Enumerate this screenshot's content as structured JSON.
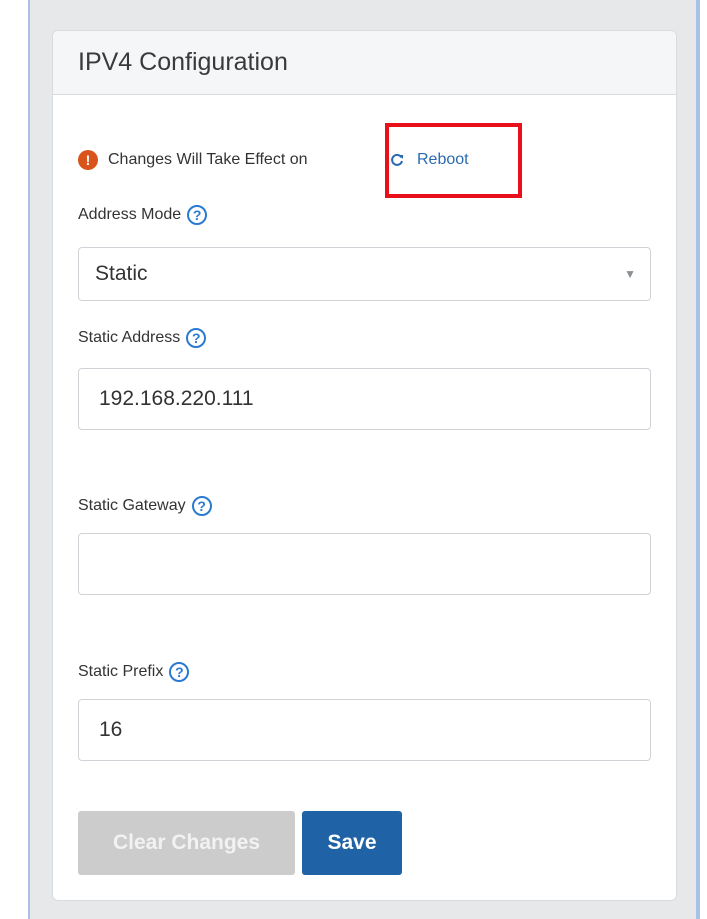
{
  "panel": {
    "title": "IPV4 Configuration"
  },
  "notice": {
    "text": "Changes Will Take Effect on",
    "icon": "exclamation-icon",
    "link_label": "Reboot",
    "link_icon": "refresh-icon"
  },
  "fields": {
    "address_mode": {
      "label": "Address Mode",
      "value": "Static"
    },
    "static_address": {
      "label": "Static Address",
      "value": "192.168.220.111"
    },
    "static_gateway": {
      "label": "Static Gateway",
      "value": ""
    },
    "static_prefix": {
      "label": "Static Prefix",
      "value": "16"
    }
  },
  "help_symbol": "?",
  "buttons": {
    "clear_label": "Clear Changes",
    "save_label": "Save"
  },
  "colors": {
    "accent": "#1f62a6",
    "link": "#2a6bb0",
    "warning": "#d9541a",
    "help": "#2a7bd0",
    "highlight": "#e8101b"
  }
}
